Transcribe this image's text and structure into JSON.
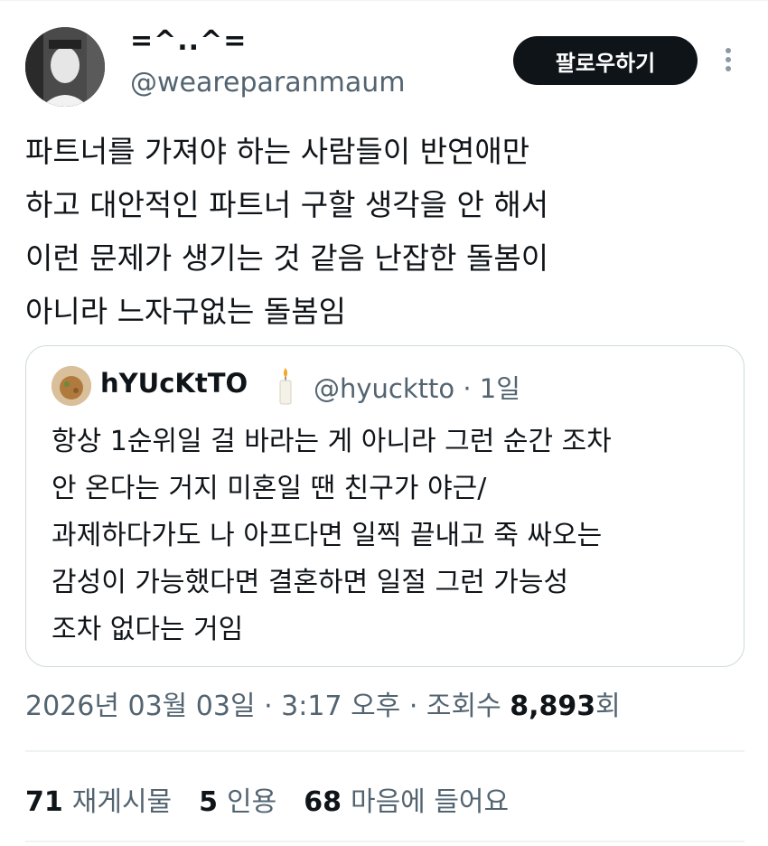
{
  "author": {
    "display_name": "=^..^=",
    "handle": "@weareparanmaum"
  },
  "follow_label": "팔로우하기",
  "tweet_text": "파트너를 가져야 하는 사람들이 반연애만\n하고 대안적인 파트너 구할 생각을 안 해서\n이런 문제가 생기는 것 같음 난잡한 돌봄이\n아니라 느자구없는 돌봄임",
  "quoted": {
    "name": "hYUcKtTO",
    "handle_time": "@hyucktto · 1일",
    "text": "항상 1순위일 걸 바라는 게 아니라 그런 순간 조차\n안 온다는 거지 미혼일 땐 친구가 야근/\n과제하다가도 나 아프다면 일찍 끝내고 죽 싸오는\n감성이 가능했다면 결혼하면 일절 그런 가능성\n조차 없다는 거임"
  },
  "meta": {
    "datetime": "2026년 03월 03일 · 3:17 오후 · 조회수 ",
    "views": "8,893",
    "views_suffix": "회"
  },
  "stats": {
    "reposts_count": "71",
    "reposts_label": "재게시물",
    "quotes_count": "5",
    "quotes_label": "인용",
    "likes_count": "68",
    "likes_label": "마음에 들어요"
  },
  "colors": {
    "text": "#0f1419",
    "secondary": "#536471",
    "border": "#cfd9de",
    "follow_bg": "#0f1419"
  }
}
